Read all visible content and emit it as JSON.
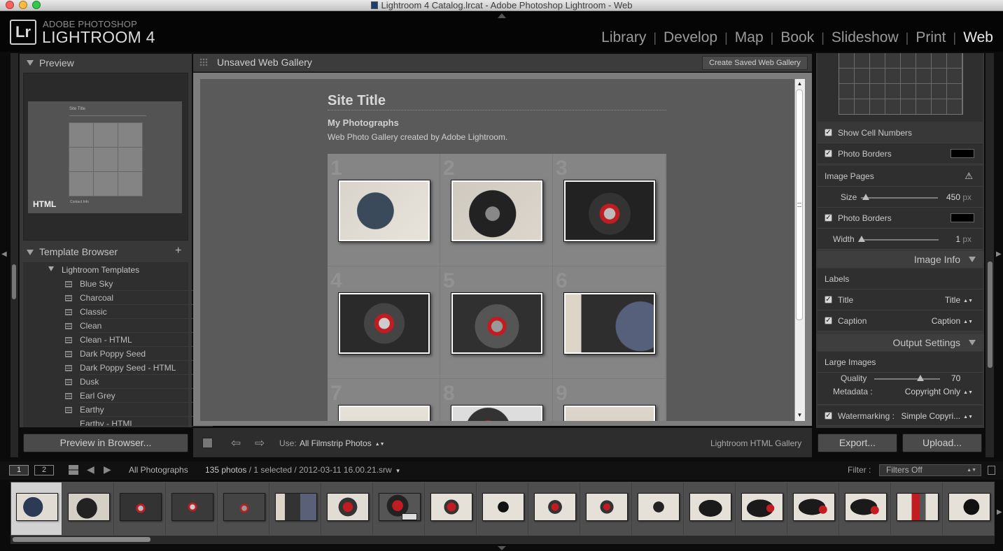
{
  "window": {
    "title": "Lightroom 4 Catalog.lrcat - Adobe Photoshop Lightroom - Web"
  },
  "brand": {
    "logo": "Lr",
    "small": "ADOBE PHOTOSHOP",
    "big": "LIGHTROOM 4"
  },
  "modules": [
    "Library",
    "Develop",
    "Map",
    "Book",
    "Slideshow",
    "Print",
    "Web"
  ],
  "active_module": "Web",
  "left": {
    "preview_header": "Preview",
    "preview_thumb_label": "HTML",
    "mini_preview": {
      "title": "Site Title",
      "footer": "Contact Info"
    },
    "template_browser_header": "Template Browser",
    "folder": "Lightroom Templates",
    "templates": [
      "Blue Sky",
      "Charcoal",
      "Classic",
      "Clean",
      "Clean - HTML",
      "Dark Poppy Seed",
      "Dark Poppy Seed - HTML",
      "Dusk",
      "Earl Grey",
      "Earthy",
      "Earthy - HTML"
    ],
    "preview_button": "Preview in Browser..."
  },
  "center": {
    "header": "Unsaved Web Gallery",
    "create_button": "Create Saved Web Gallery",
    "site_title": "Site Title",
    "collection_title": "My Photographs",
    "description": "Web Photo Gallery created by Adobe Lightroom.",
    "cell_numbers": [
      "1",
      "2",
      "3",
      "4",
      "5",
      "6",
      "7",
      "8",
      "9"
    ]
  },
  "toolbar": {
    "use_label": "Use:",
    "use_value": "All Filmstrip Photos",
    "engine": "Lightroom HTML Gallery"
  },
  "right": {
    "show_cell_numbers": "Show Cell Numbers",
    "photo_borders": "Photo Borders",
    "image_pages": "Image Pages",
    "size_label": "Size",
    "size_value": "450",
    "size_unit": "px",
    "size_fraction": 0.06,
    "photo_borders_2": "Photo Borders",
    "width_label": "Width",
    "width_value": "1",
    "width_unit": "px",
    "width_fraction": 0.0,
    "image_info_header": "Image Info",
    "labels": "Labels",
    "title_label": "Title",
    "title_value": "Title",
    "caption_label": "Caption",
    "caption_value": "Caption",
    "output_header": "Output Settings",
    "large_images": "Large Images",
    "quality_label": "Quality",
    "quality_value": "70",
    "quality_fraction": 0.7,
    "metadata_label": "Metadata :",
    "metadata_value": "Copyright Only",
    "watermark_label": "Watermarking :",
    "watermark_value": "Simple Copyri...",
    "export_button": "Export...",
    "upload_button": "Upload..."
  },
  "filmstrip": {
    "screen1": "1",
    "screen2": "2",
    "source": "All Photographs",
    "count": "135 photos",
    "selection": " / 1 selected / 2012-03-11 16.00.21.srw",
    "filter_label": "Filter :",
    "filter_value": "Filters Off"
  },
  "colors": {
    "accent_red": "#c01c22",
    "panel_bg": "#383838",
    "canvas_bg": "#5a5a5a"
  }
}
